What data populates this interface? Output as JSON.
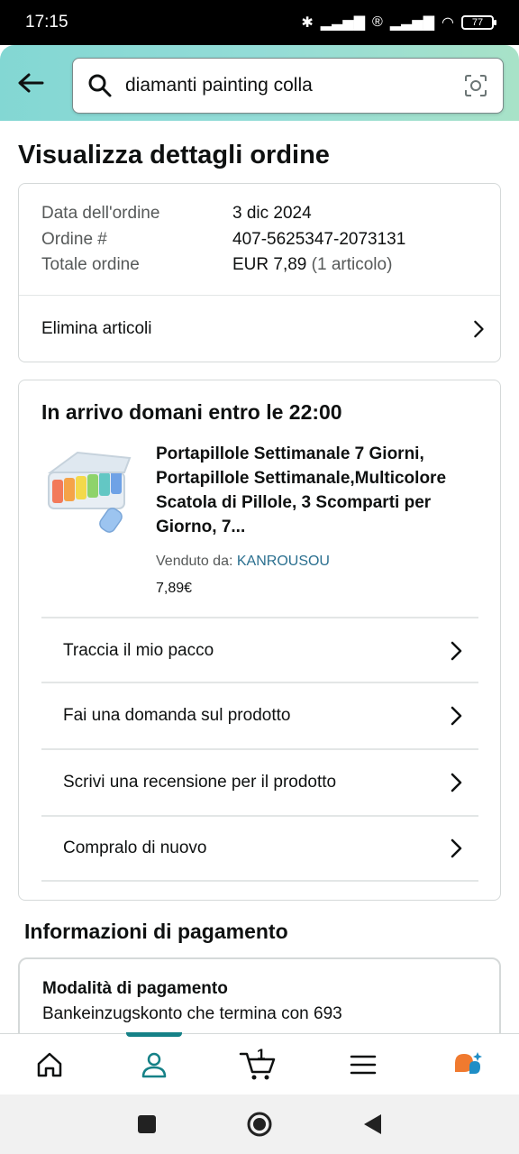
{
  "status": {
    "time": "17:15",
    "battery": "77"
  },
  "search": {
    "query": "diamanti painting colla"
  },
  "page": {
    "title": "Visualizza dettagli ordine"
  },
  "order": {
    "date_label": "Data dell'ordine",
    "date_value": "3 dic 2024",
    "number_label": "Ordine #",
    "number_value": "407-5625347-2073131",
    "total_label": "Totale ordine",
    "total_value": "EUR 7,89",
    "total_items": "(1 articolo)",
    "delete_items": "Elimina articoli"
  },
  "shipment": {
    "arrival": "In arrivo domani entro le 22:00",
    "product_title": "Portapillole Settimanale 7 Giorni, Portapillole Settimanale,Multicolore Scatola di Pillole, 3 Scomparti per Giorno, 7...",
    "sold_by_label": "Venduto da: ",
    "seller": "KANROUSOU",
    "price": "7,89€",
    "actions": [
      "Traccia il mio pacco",
      "Fai una domanda sul prodotto",
      "Scrivi una recensione per il prodotto",
      "Compralo di nuovo"
    ]
  },
  "payment": {
    "section_title": "Informazioni di pagamento",
    "method_label": "Modalità di pagamento",
    "method_value": "Bankeinzugskonto che termina con 693"
  },
  "nav": {
    "cart_count": "1"
  },
  "colors": {
    "accent": "#158187",
    "header_gradient_start": "#83d7d3",
    "header_gradient_end": "#a8e2c8"
  }
}
